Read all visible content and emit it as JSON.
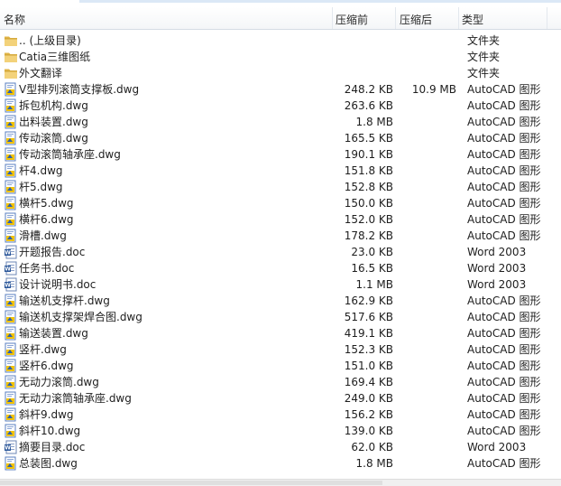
{
  "columns": {
    "name": "名称",
    "size": "压缩前",
    "compressed": "压缩后",
    "type": "类型"
  },
  "rows": [
    {
      "icon": "folder-icon",
      "name": ".. (上级目录)",
      "size": "",
      "compressed": "",
      "type": "文件夹"
    },
    {
      "icon": "folder-icon",
      "name": "Catia三维图纸",
      "size": "",
      "compressed": "",
      "type": "文件夹"
    },
    {
      "icon": "folder-icon",
      "name": "外文翻译",
      "size": "",
      "compressed": "",
      "type": "文件夹"
    },
    {
      "icon": "dwg-file-icon",
      "name": "V型排列滚筒支撑板.dwg",
      "size": "248.2 KB",
      "compressed": "10.9 MB",
      "type": "AutoCAD 图形"
    },
    {
      "icon": "dwg-file-icon",
      "name": "拆包机构.dwg",
      "size": "263.6 KB",
      "compressed": "",
      "type": "AutoCAD 图形"
    },
    {
      "icon": "dwg-file-icon",
      "name": "出料装置.dwg",
      "size": "1.8 MB",
      "compressed": "",
      "type": "AutoCAD 图形"
    },
    {
      "icon": "dwg-file-icon",
      "name": "传动滚筒.dwg",
      "size": "165.5 KB",
      "compressed": "",
      "type": "AutoCAD 图形"
    },
    {
      "icon": "dwg-file-icon",
      "name": "传动滚筒轴承座.dwg",
      "size": "190.1 KB",
      "compressed": "",
      "type": "AutoCAD 图形"
    },
    {
      "icon": "dwg-file-icon",
      "name": "杆4.dwg",
      "size": "151.8 KB",
      "compressed": "",
      "type": "AutoCAD 图形"
    },
    {
      "icon": "dwg-file-icon",
      "name": "杆5.dwg",
      "size": "152.8 KB",
      "compressed": "",
      "type": "AutoCAD 图形"
    },
    {
      "icon": "dwg-file-icon",
      "name": "横杆5.dwg",
      "size": "150.0 KB",
      "compressed": "",
      "type": "AutoCAD 图形"
    },
    {
      "icon": "dwg-file-icon",
      "name": "横杆6.dwg",
      "size": "152.0 KB",
      "compressed": "",
      "type": "AutoCAD 图形"
    },
    {
      "icon": "dwg-file-icon",
      "name": "滑槽.dwg",
      "size": "178.2 KB",
      "compressed": "",
      "type": "AutoCAD 图形"
    },
    {
      "icon": "doc-file-icon",
      "name": "开题报告.doc",
      "size": "23.0 KB",
      "compressed": "",
      "type": "Word 2003"
    },
    {
      "icon": "doc-file-icon",
      "name": "任务书.doc",
      "size": "16.5 KB",
      "compressed": "",
      "type": "Word 2003"
    },
    {
      "icon": "doc-file-icon",
      "name": "设计说明书.doc",
      "size": "1.1 MB",
      "compressed": "",
      "type": "Word 2003"
    },
    {
      "icon": "dwg-file-icon",
      "name": "输送机支撑杆.dwg",
      "size": "162.9 KB",
      "compressed": "",
      "type": "AutoCAD 图形"
    },
    {
      "icon": "dwg-file-icon",
      "name": "输送机支撑架焊合图.dwg",
      "size": "517.6 KB",
      "compressed": "",
      "type": "AutoCAD 图形"
    },
    {
      "icon": "dwg-file-icon",
      "name": "输送装置.dwg",
      "size": "419.1 KB",
      "compressed": "",
      "type": "AutoCAD 图形"
    },
    {
      "icon": "dwg-file-icon",
      "name": "竖杆.dwg",
      "size": "152.3 KB",
      "compressed": "",
      "type": "AutoCAD 图形"
    },
    {
      "icon": "dwg-file-icon",
      "name": "竖杆6.dwg",
      "size": "151.0 KB",
      "compressed": "",
      "type": "AutoCAD 图形"
    },
    {
      "icon": "dwg-file-icon",
      "name": "无动力滚筒.dwg",
      "size": "169.4 KB",
      "compressed": "",
      "type": "AutoCAD 图形"
    },
    {
      "icon": "dwg-file-icon",
      "name": "无动力滚筒轴承座.dwg",
      "size": "249.0 KB",
      "compressed": "",
      "type": "AutoCAD 图形"
    },
    {
      "icon": "dwg-file-icon",
      "name": "斜杆9.dwg",
      "size": "156.2 KB",
      "compressed": "",
      "type": "AutoCAD 图形"
    },
    {
      "icon": "dwg-file-icon",
      "name": "斜杆10.dwg",
      "size": "139.0 KB",
      "compressed": "",
      "type": "AutoCAD 图形"
    },
    {
      "icon": "doc-file-icon",
      "name": "摘要目录.doc",
      "size": "62.0 KB",
      "compressed": "",
      "type": "Word 2003"
    },
    {
      "icon": "dwg-file-icon",
      "name": "总装图.dwg",
      "size": "1.8 MB",
      "compressed": "",
      "type": "AutoCAD 图形"
    }
  ],
  "colors": {
    "folder": "#e8c25a",
    "dwg_yellow": "#f2c200",
    "dwg_blue": "#2a5fb0",
    "doc_blue": "#2b579a"
  }
}
